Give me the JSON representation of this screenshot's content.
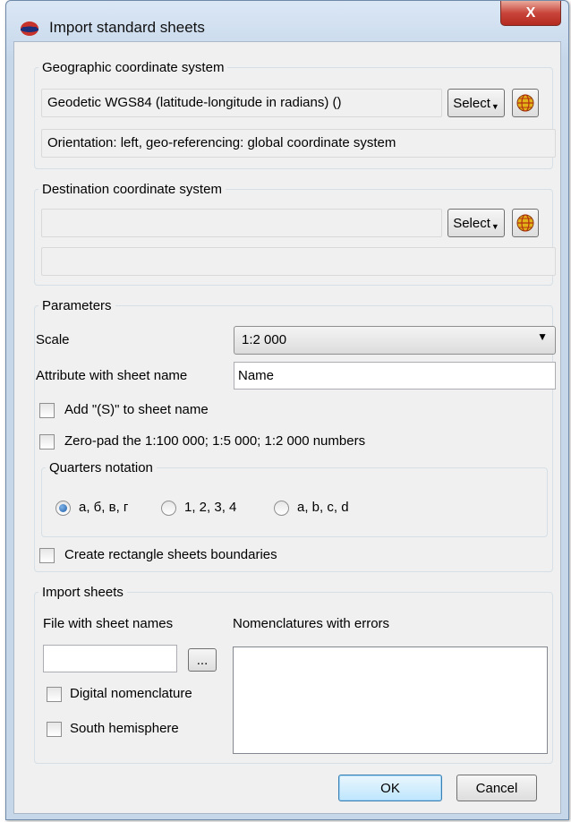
{
  "window": {
    "title": "Import standard sheets",
    "close_label": "X"
  },
  "geographic": {
    "legend": "Geographic coordinate system",
    "system_value": "Geodetic WGS84 (latitude-longitude in radians) ()",
    "select_label": "Select",
    "info": "Orientation: left, geo-referencing: global coordinate system"
  },
  "destination": {
    "legend": "Destination coordinate system",
    "system_value": "",
    "select_label": "Select",
    "info": ""
  },
  "parameters": {
    "legend": "Parameters",
    "scale_label": "Scale",
    "scale_value": "1:2 000",
    "attribute_label": "Attribute with sheet name",
    "attribute_value": "Name",
    "add_s_label": "Add \"(S)\" to sheet name",
    "add_s_checked": false,
    "zero_pad_label": "Zero-pad the 1:100 000; 1:5 000; 1:2 000 numbers",
    "zero_pad_checked": false,
    "quarters": {
      "legend": "Quarters notation",
      "options": [
        "а, б, в, г",
        "1, 2, 3, 4",
        "a, b, c, d"
      ],
      "selected_index": 0
    },
    "rect_boundaries_label": "Create rectangle sheets boundaries",
    "rect_boundaries_checked": false
  },
  "import_sheets": {
    "legend": "Import sheets",
    "file_label": "File with sheet names",
    "file_value": "",
    "browse_label": "...",
    "errors_label": "Nomenclatures with errors",
    "digital_label": "Digital nomenclature",
    "digital_checked": false,
    "south_label": "South hemisphere",
    "south_checked": false
  },
  "footer": {
    "ok_label": "OK",
    "cancel_label": "Cancel"
  },
  "colors": {
    "window_frame": "#c6d7ea",
    "client_bg": "#f0f0f0",
    "close_red": "#c8453b"
  }
}
